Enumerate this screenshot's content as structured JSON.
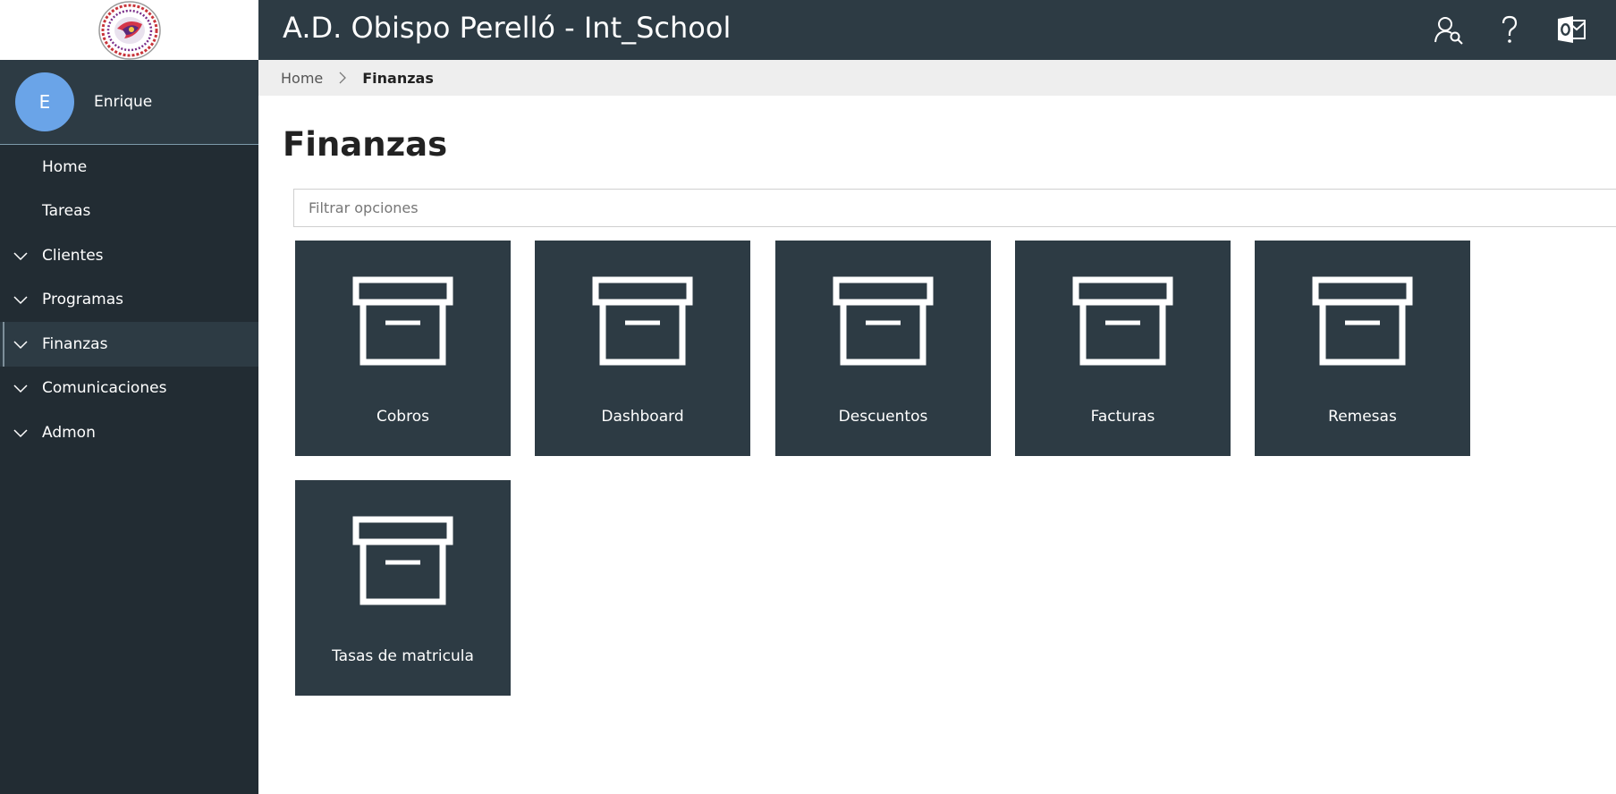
{
  "header": {
    "title": "A.D. Obispo Perelló - Int_School",
    "icons": [
      "user-search-icon",
      "help-icon",
      "outlook-icon"
    ]
  },
  "user": {
    "initial": "E",
    "name": "Enrique"
  },
  "sidebar": {
    "items": [
      {
        "label": "Home",
        "expandable": false,
        "active": false
      },
      {
        "label": "Tareas",
        "expandable": false,
        "active": false
      },
      {
        "label": "Clientes",
        "expandable": true,
        "active": false
      },
      {
        "label": "Programas",
        "expandable": true,
        "active": false
      },
      {
        "label": "Finanzas",
        "expandable": true,
        "active": true
      },
      {
        "label": "Comunicaciones",
        "expandable": true,
        "active": false
      },
      {
        "label": "Admon",
        "expandable": true,
        "active": false
      }
    ]
  },
  "breadcrumb": {
    "home": "Home",
    "current": "Finanzas"
  },
  "main": {
    "title": "Finanzas",
    "filter": {
      "value": "",
      "placeholder": "Filtrar opciones"
    },
    "tiles": [
      {
        "label": "Cobros",
        "icon": "archive-box-icon"
      },
      {
        "label": "Dashboard",
        "icon": "archive-box-icon"
      },
      {
        "label": "Descuentos",
        "icon": "archive-box-icon"
      },
      {
        "label": "Facturas",
        "icon": "archive-box-icon"
      },
      {
        "label": "Remesas",
        "icon": "archive-box-icon"
      },
      {
        "label": "Tasas de matricula",
        "icon": "archive-box-icon"
      }
    ]
  },
  "colors": {
    "sidebar_bg": "#222c33",
    "header_bg": "#2d3b44",
    "tile_bg": "#2d3b44",
    "avatar_bg": "#6aa4e8",
    "breadcrumb_bg": "#eeeeee"
  }
}
